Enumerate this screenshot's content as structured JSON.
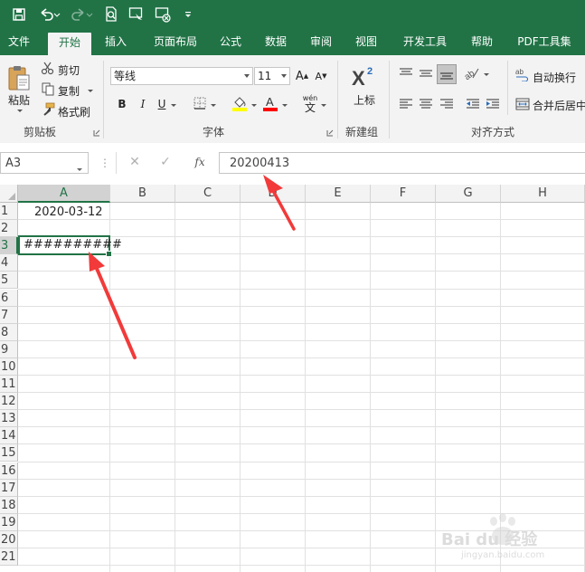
{
  "titlebar": {
    "icons": [
      "save-icon",
      "undo-icon",
      "redo-icon",
      "print-preview-icon",
      "form-icon",
      "clear-icon",
      "customize-icon"
    ],
    "bg_color": "#217346"
  },
  "tabs": [
    "文件",
    "开始",
    "插入",
    "页面布局",
    "公式",
    "数据",
    "审阅",
    "视图",
    "开发工具",
    "帮助",
    "PDF工具集"
  ],
  "active_tab": "开始",
  "ribbon": {
    "clipboard": {
      "paste": "粘贴",
      "cut": "剪切",
      "copy": "复制",
      "format_painter": "格式刷",
      "label": "剪贴板"
    },
    "font": {
      "font_name": "等线",
      "font_size": "11",
      "bold": "B",
      "italic": "I",
      "underline": "U",
      "phonetic": "wén",
      "label": "字体",
      "fill_color": "#ffff00",
      "font_color": "#ff0000"
    },
    "newgroup": {
      "superscript_label": "上标",
      "label": "新建组"
    },
    "align": {
      "wrap_text": "自动换行",
      "merge_center": "合并后居中",
      "label": "对齐方式"
    }
  },
  "formula_bar": {
    "name_box": "A3",
    "cancel": "✕",
    "enter": "✓",
    "fx": "fx",
    "content": "20200413"
  },
  "sheet": {
    "columns": [
      "A",
      "B",
      "C",
      "D",
      "E",
      "F",
      "G",
      "H"
    ],
    "rows": [
      "1",
      "2",
      "3",
      "4",
      "5",
      "6",
      "7",
      "8",
      "9",
      "10",
      "11",
      "12",
      "13",
      "14",
      "15",
      "16",
      "17",
      "18",
      "19",
      "20",
      "21"
    ],
    "cells": {
      "A1": "2020-03-12",
      "A3": "##########"
    },
    "selected": "A3",
    "accent_color": "#217346"
  },
  "annotation": {
    "arrow_color": "#f23a3a"
  },
  "watermark": {
    "brand": "Bai du 经验",
    "url": "jingyan.baidu.com"
  }
}
